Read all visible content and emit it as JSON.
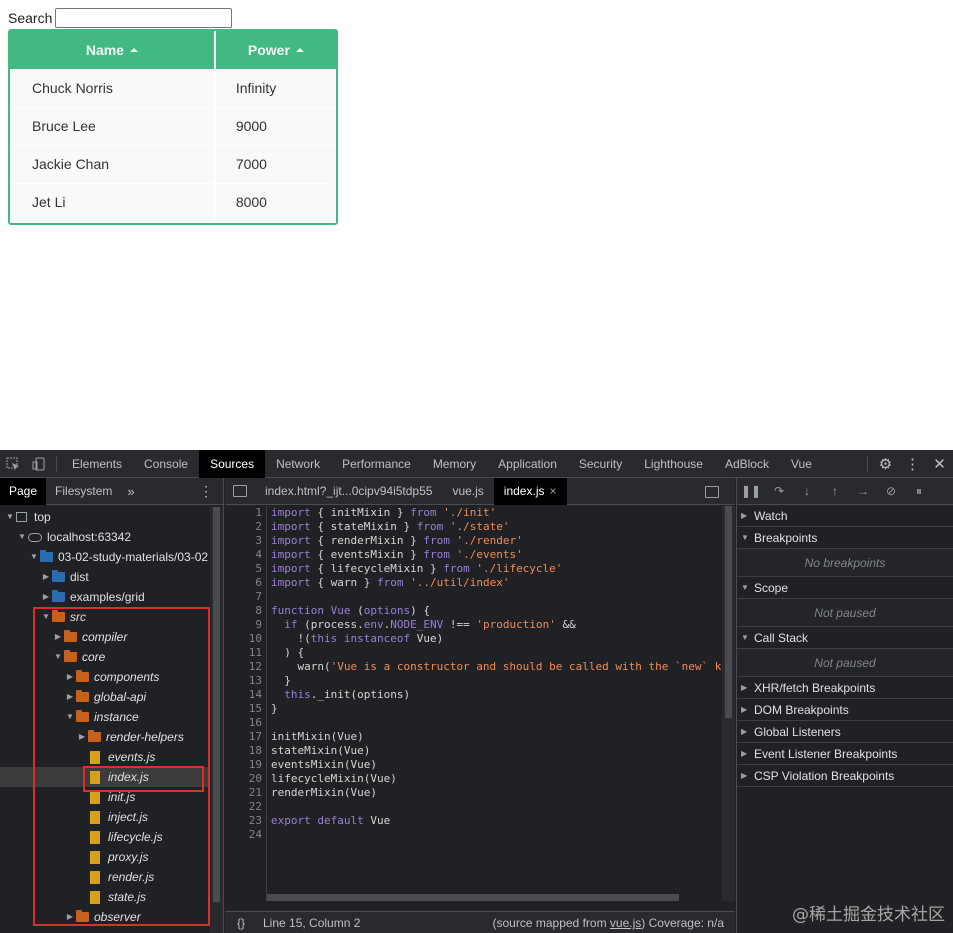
{
  "search": {
    "label": "Search",
    "value": ""
  },
  "grid": {
    "columns": [
      "Name",
      "Power"
    ],
    "rows": [
      [
        "Chuck Norris",
        "Infinity"
      ],
      [
        "Bruce Lee",
        "9000"
      ],
      [
        "Jackie Chan",
        "7000"
      ],
      [
        "Jet Li",
        "8000"
      ]
    ],
    "accent": "#42b983"
  },
  "devtools": {
    "tabs": [
      "Elements",
      "Console",
      "Sources",
      "Network",
      "Performance",
      "Memory",
      "Application",
      "Security",
      "Lighthouse",
      "AdBlock",
      "Vue"
    ],
    "active_tab": "Sources",
    "navigator": {
      "tabs": [
        "Page",
        "Filesystem"
      ],
      "more": "»",
      "tree": [
        {
          "label": "top",
          "depth": 0,
          "kind": "frame",
          "open": true
        },
        {
          "label": "localhost:63342",
          "depth": 1,
          "kind": "cloud",
          "open": true
        },
        {
          "label": "03-02-study-materials/03-02",
          "depth": 2,
          "kind": "folder-blue",
          "open": true
        },
        {
          "label": "dist",
          "depth": 3,
          "kind": "folder-blue",
          "open": false
        },
        {
          "label": "examples/grid",
          "depth": 3,
          "kind": "folder-blue",
          "open": false
        },
        {
          "label": "src",
          "depth": 3,
          "kind": "folder-orange",
          "open": true,
          "italic": true
        },
        {
          "label": "compiler",
          "depth": 4,
          "kind": "folder-orange",
          "open": false,
          "italic": true
        },
        {
          "label": "core",
          "depth": 4,
          "kind": "folder-orange",
          "open": true,
          "italic": true
        },
        {
          "label": "components",
          "depth": 5,
          "kind": "folder-orange",
          "open": false,
          "italic": true
        },
        {
          "label": "global-api",
          "depth": 5,
          "kind": "folder-orange",
          "open": false,
          "italic": true
        },
        {
          "label": "instance",
          "depth": 5,
          "kind": "folder-orange",
          "open": true,
          "italic": true
        },
        {
          "label": "render-helpers",
          "depth": 6,
          "kind": "folder-orange",
          "open": false,
          "italic": true
        },
        {
          "label": "events.js",
          "depth": 6,
          "kind": "file",
          "italic": true
        },
        {
          "label": "index.js",
          "depth": 6,
          "kind": "file",
          "italic": true,
          "selected": true
        },
        {
          "label": "init.js",
          "depth": 6,
          "kind": "file",
          "italic": true
        },
        {
          "label": "inject.js",
          "depth": 6,
          "kind": "file",
          "italic": true
        },
        {
          "label": "lifecycle.js",
          "depth": 6,
          "kind": "file",
          "italic": true
        },
        {
          "label": "proxy.js",
          "depth": 6,
          "kind": "file",
          "italic": true
        },
        {
          "label": "render.js",
          "depth": 6,
          "kind": "file",
          "italic": true
        },
        {
          "label": "state.js",
          "depth": 6,
          "kind": "file",
          "italic": true
        },
        {
          "label": "observer",
          "depth": 5,
          "kind": "folder-orange",
          "open": false,
          "italic": true
        }
      ]
    },
    "editor": {
      "tabs": [
        "index.html?_ijt...0cipv94i5tdp55",
        "vue.js",
        "index.js"
      ],
      "active_tab": "index.js",
      "close_glyph": "×",
      "lines": [
        [
          [
            "kw",
            "import"
          ],
          [
            "t",
            " { initMixin } "
          ],
          [
            "kw",
            "from"
          ],
          [
            "t",
            " "
          ],
          [
            "str",
            "'./init'"
          ]
        ],
        [
          [
            "kw",
            "import"
          ],
          [
            "t",
            " { stateMixin } "
          ],
          [
            "kw",
            "from"
          ],
          [
            "t",
            " "
          ],
          [
            "str",
            "'./state'"
          ]
        ],
        [
          [
            "kw",
            "import"
          ],
          [
            "t",
            " { renderMixin } "
          ],
          [
            "kw",
            "from"
          ],
          [
            "t",
            " "
          ],
          [
            "str",
            "'./render'"
          ]
        ],
        [
          [
            "kw",
            "import"
          ],
          [
            "t",
            " { eventsMixin } "
          ],
          [
            "kw",
            "from"
          ],
          [
            "t",
            " "
          ],
          [
            "str",
            "'./events'"
          ]
        ],
        [
          [
            "kw",
            "import"
          ],
          [
            "t",
            " { lifecycleMixin } "
          ],
          [
            "kw",
            "from"
          ],
          [
            "t",
            " "
          ],
          [
            "str",
            "'./lifecycle'"
          ]
        ],
        [
          [
            "kw",
            "import"
          ],
          [
            "t",
            " { warn } "
          ],
          [
            "kw",
            "from"
          ],
          [
            "t",
            " "
          ],
          [
            "str",
            "'../util/index'"
          ]
        ],
        [],
        [
          [
            "kw",
            "function"
          ],
          [
            "t",
            " "
          ],
          [
            "kw",
            "Vue"
          ],
          [
            "t",
            " ("
          ],
          [
            "kw",
            "options"
          ],
          [
            "t",
            ") {"
          ]
        ],
        [
          [
            "t",
            "  "
          ],
          [
            "kw",
            "if"
          ],
          [
            "t",
            " (process."
          ],
          [
            "kw",
            "env"
          ],
          [
            "t",
            "."
          ],
          [
            "kw",
            "NODE_ENV"
          ],
          [
            "t",
            " !== "
          ],
          [
            "str",
            "'production'"
          ],
          [
            "t",
            " &&"
          ]
        ],
        [
          [
            "t",
            "    !("
          ],
          [
            "kw",
            "this"
          ],
          [
            "t",
            " "
          ],
          [
            "kw",
            "instanceof"
          ],
          [
            "t",
            " Vue)"
          ]
        ],
        [
          [
            "t",
            "  ) {"
          ]
        ],
        [
          [
            "t",
            "    warn("
          ],
          [
            "str",
            "'Vue is a constructor and should be called with the `new` ke"
          ]
        ],
        [
          [
            "t",
            "  }"
          ]
        ],
        [
          [
            "t",
            "  "
          ],
          [
            "kw",
            "this"
          ],
          [
            "t",
            "._init(options)"
          ]
        ],
        [
          [
            "t",
            "}"
          ]
        ],
        [],
        [
          [
            "t",
            "initMixin(Vue)"
          ]
        ],
        [
          [
            "t",
            "stateMixin(Vue)"
          ]
        ],
        [
          [
            "t",
            "eventsMixin(Vue)"
          ]
        ],
        [
          [
            "t",
            "lifecycleMixin(Vue)"
          ]
        ],
        [
          [
            "t",
            "renderMixin(Vue)"
          ]
        ],
        [],
        [
          [
            "kw",
            "export"
          ],
          [
            "t",
            " "
          ],
          [
            "kw",
            "default"
          ],
          [
            "t",
            " Vue"
          ]
        ],
        []
      ],
      "line_numbers": [
        "1",
        "2",
        "3",
        "4",
        "5",
        "6",
        "7",
        "8",
        "9",
        "10",
        "11",
        "12",
        "13",
        "14",
        "15",
        "16",
        "17",
        "18",
        "19",
        "20",
        "21",
        "22",
        "23",
        "24"
      ],
      "status_braces": "{}",
      "cursor": "Line 15, Column 2",
      "source_mapped_prefix": "(source mapped from ",
      "source_mapped_link": "vue.js",
      "source_mapped_suffix": ")",
      "coverage": "Coverage: n/a"
    },
    "debugger": {
      "panes": [
        {
          "title": "Watch",
          "open": false
        },
        {
          "title": "Breakpoints",
          "open": true,
          "body": "No breakpoints"
        },
        {
          "title": "Scope",
          "open": true,
          "body": "Not paused"
        },
        {
          "title": "Call Stack",
          "open": true,
          "body": "Not paused"
        },
        {
          "title": "XHR/fetch Breakpoints",
          "open": false
        },
        {
          "title": "DOM Breakpoints",
          "open": false
        },
        {
          "title": "Global Listeners",
          "open": false
        },
        {
          "title": "Event Listener Breakpoints",
          "open": false
        },
        {
          "title": "CSP Violation Breakpoints",
          "open": false
        }
      ]
    }
  },
  "watermark": "@稀土掘金技术社区"
}
